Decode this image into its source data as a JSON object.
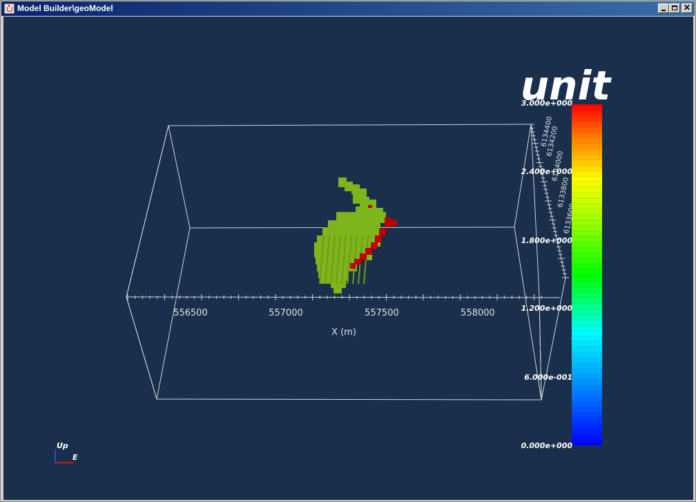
{
  "window": {
    "title": "Model Builder\\geoModel",
    "minimize_icon": "minimize-icon",
    "maximize_icon": "maximize-icon",
    "close_icon": "close-icon"
  },
  "viewport": {
    "background": "#1a2f4b",
    "x_axis": {
      "ticks": [
        "556500",
        "557000",
        "557500",
        "558000"
      ],
      "label": "X (m)"
    },
    "y_axis": {
      "ticks": [
        "6133600",
        "6133800",
        "6134000",
        "6134200",
        "6134400"
      ]
    },
    "legend": {
      "title": "unit",
      "labels": [
        "3.000e+000",
        "2.400e+000",
        "1.800e+000",
        "1.200e+000",
        "6.000e-001",
        "0.000e+000"
      ],
      "colormap": "rainbow (blue to red)"
    },
    "orientation": {
      "up_label": "Up",
      "east_label": "E"
    },
    "model_colors": {
      "unit_low": "#7eb41c",
      "unit_high": "#c00000"
    }
  }
}
